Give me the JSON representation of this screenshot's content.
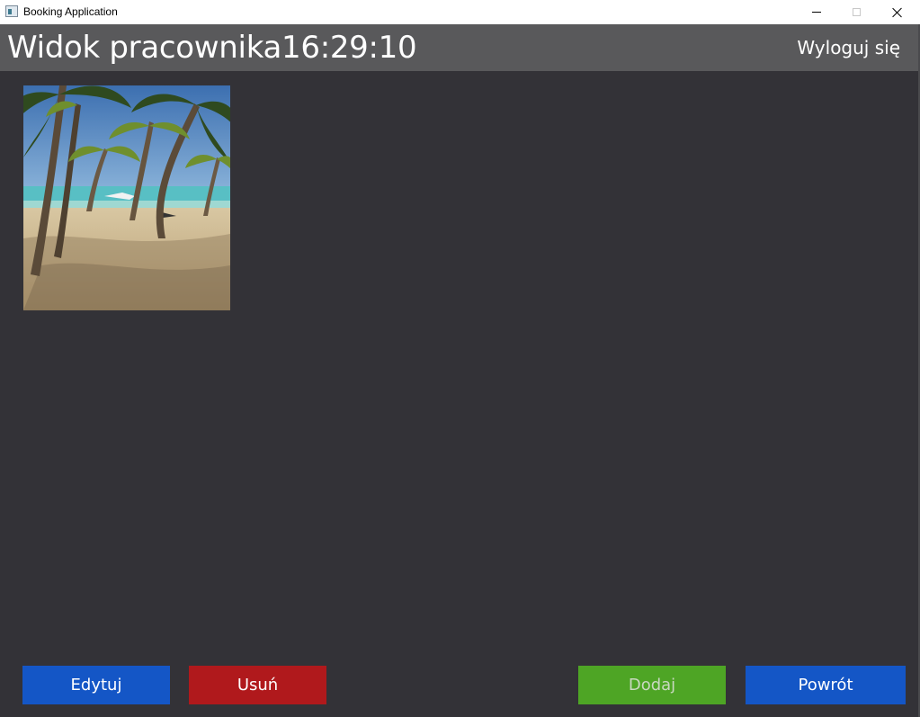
{
  "window": {
    "title": "Booking Application"
  },
  "header": {
    "title": "Widok pracownika",
    "clock": "16:29:10",
    "logout_label": "Wyloguj się"
  },
  "content": {
    "photo": {
      "subject": "beach-with-palm-trees"
    }
  },
  "actions": {
    "edit_label": "Edytuj",
    "delete_label": "Usuń",
    "add_label": "Dodaj",
    "back_label": "Powrót"
  },
  "colors": {
    "background": "#333237",
    "header": "#59595b",
    "edit": "#1456c6",
    "delete": "#b0191c",
    "add": "#4ea525",
    "back": "#1456c6"
  }
}
